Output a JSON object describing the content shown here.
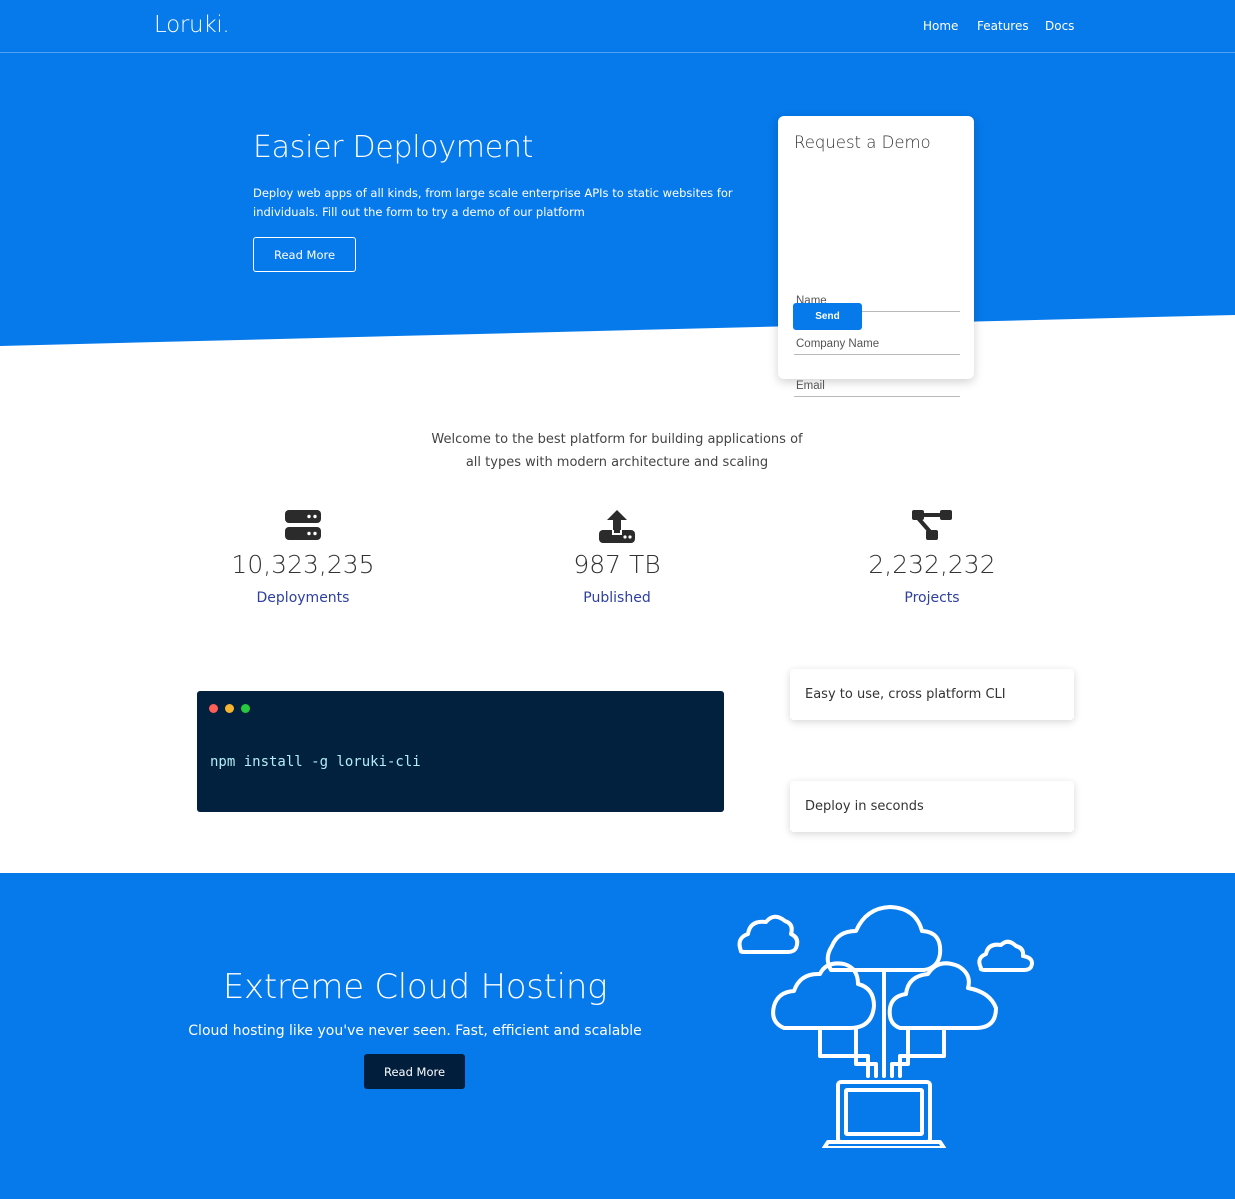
{
  "brand": {
    "logo": "Loruki.",
    "primary_color": "#0679eb",
    "dark_color": "#011f3d"
  },
  "nav": {
    "items": [
      "Home",
      "Features",
      "Docs"
    ]
  },
  "hero": {
    "title": "Easier Deployment",
    "text": "Deploy web apps of all kinds, from large scale enterprise APIs to static websites for individuals. Fill out the form to try a demo of our platform",
    "button_label": "Read More"
  },
  "demo_form": {
    "title": "Request a Demo",
    "name_placeholder": "Name",
    "company_placeholder": "Company Name",
    "email_placeholder": "Email",
    "send_label": "Send"
  },
  "welcome": "Welcome to the best platform for building applications of all types with modern architecture and scaling",
  "stats": [
    {
      "icon": "server-icon",
      "value": "10,323,235",
      "label": "Deployments"
    },
    {
      "icon": "upload-icon",
      "value": "987 TB",
      "label": "Published"
    },
    {
      "icon": "project-diagram-icon",
      "value": "2,232,232",
      "label": "Projects"
    }
  ],
  "terminal": {
    "command": "npm install -g loruki-cli"
  },
  "features": [
    "Easy to use, cross platform CLI",
    "Deploy in seconds"
  ],
  "cloud": {
    "title": "Extreme Cloud Hosting",
    "subtitle": "Cloud hosting like you've never seen. Fast, efficient and scalable",
    "button_label": "Read More",
    "illustration": "cloud-computing-icon"
  }
}
